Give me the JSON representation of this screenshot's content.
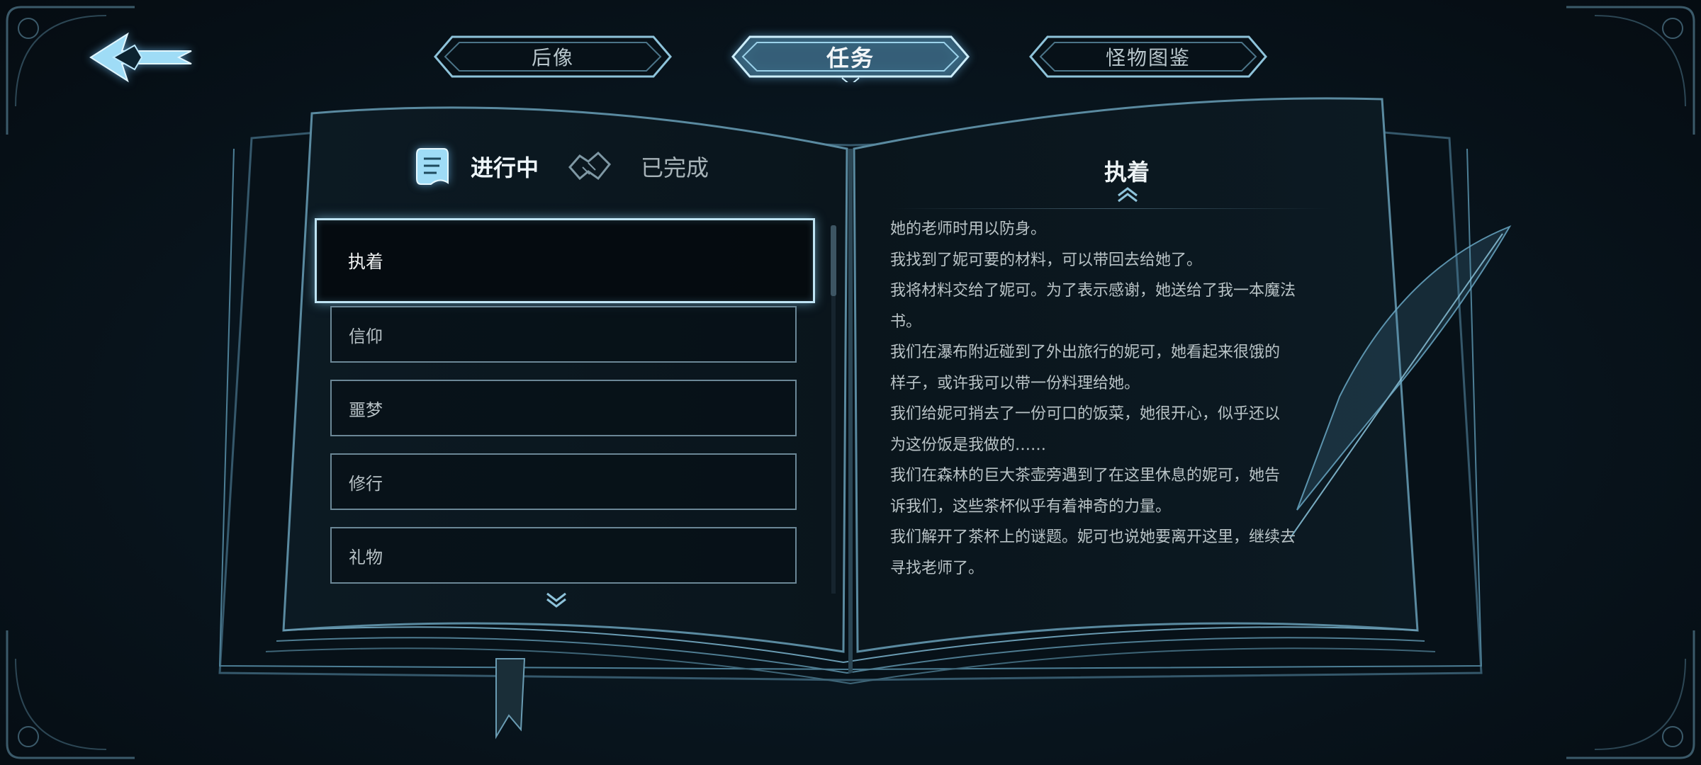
{
  "nav": {
    "tabs": [
      {
        "label": "后像",
        "active": false
      },
      {
        "label": "任务",
        "active": true
      },
      {
        "label": "怪物图鉴",
        "active": false
      }
    ]
  },
  "filters": {
    "ongoing_label": "进行中",
    "completed_label": "已完成",
    "selected": "ongoing"
  },
  "quests": [
    "执着",
    "信仰",
    "噩梦",
    "修行",
    "礼物"
  ],
  "selected_quest": "执着",
  "detail": {
    "title": "执着",
    "log": [
      "她的老师时用以防身。",
      "我找到了妮可要的材料，可以带回去给她了。",
      "我将材料交给了妮可。为了表示感谢，她送给了我一本魔法",
      "书。",
      "我们在瀑布附近碰到了外出旅行的妮可，她看起来很饿的",
      "样子，或许我可以带一份料理给她。",
      "我们给妮可捎去了一份可口的饭菜，她很开心，似乎还以",
      "为这份饭是我做的……",
      "我们在森林的巨大茶壶旁遇到了在这里休息的妮可，她告",
      "诉我们，这些茶杯似乎有着神奇的力量。",
      "我们解开了茶杯上的谜题。妮可也说她要离开这里，继续去",
      "寻找老师了。"
    ]
  },
  "colors": {
    "background": "#09161f",
    "accent_glow": "#8fd4f4",
    "frame_line": "#6b8796",
    "text_primary": "#f2f6f8",
    "text_secondary": "#b8c2c6"
  },
  "icons": {
    "back": "back-arrow-icon",
    "ongoing": "scroll-icon",
    "completed": "handshake-icon",
    "list_down": "chevron-down-icon",
    "detail_up": "chevron-up-icon"
  }
}
